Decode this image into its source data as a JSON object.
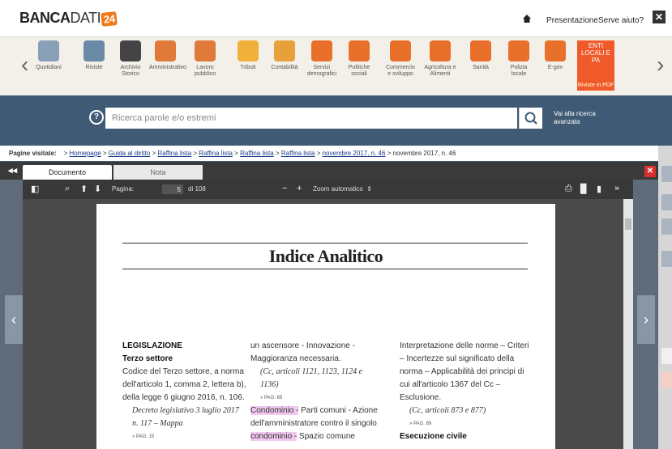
{
  "brand": {
    "name_bold": "BANCA",
    "name_light": "DATI",
    "badge": "24"
  },
  "header": {
    "presentazione": "Presentazione",
    "serve_aiuto": "Serve aiuto?",
    "close": "✕"
  },
  "categories": [
    {
      "label": "Quotidiani",
      "color": "#8aa0b8"
    },
    {
      "label": "Riviste",
      "color": "#6a8aa8"
    },
    {
      "label": "Archivio Storico",
      "color": "#444444"
    },
    {
      "label": "Amministrativo",
      "color": "#e07a3a"
    },
    {
      "label": "Lavoro pubblico",
      "color": "#e07a3a"
    },
    {
      "label": "Tributi",
      "color": "#f0b03a"
    },
    {
      "label": "Contabilità",
      "color": "#e8a03a"
    },
    {
      "label": "Servizi demografici",
      "color": "#e8702a"
    },
    {
      "label": "Politiche sociali",
      "color": "#e8702a"
    },
    {
      "label": "Commercio e sviluppo",
      "color": "#e8702a"
    },
    {
      "label": "Agricoltura e Alimenti",
      "color": "#e8702a"
    },
    {
      "label": "Sanità",
      "color": "#e8702a"
    },
    {
      "label": "Polizia locale",
      "color": "#e8702a"
    },
    {
      "label": "E-gov",
      "color": "#e8702a"
    }
  ],
  "enti": {
    "title": "ENTI LOCALI E PA",
    "sub": "Riviste in PDF"
  },
  "search": {
    "placeholder": "Ricerca parole e/o estremi",
    "advanced": "Vai alla ricerca avanzata",
    "help": "?"
  },
  "visited": {
    "label": "Pagine visitate:",
    "crumbs": [
      "Homepage",
      "Guida al diritto",
      "Raffina lista",
      "Raffina lista",
      "Raffina lista",
      "Raffina lista",
      "novembre 2017, n. 46"
    ],
    "current": "novembre 2017, n. 46"
  },
  "tabs": {
    "documento": "Documento",
    "nota": "Nota"
  },
  "pdf": {
    "page_label": "Pagina:",
    "page_value": "5",
    "page_of": "di 108",
    "zoom": "Zoom automatico"
  },
  "page": {
    "title": "Indice Analitico",
    "col1": {
      "h1": "LEGISLAZIONE",
      "h2": "Terzo settore",
      "l1": "Codice del Terzo settore, a norma",
      "l2": "dell'articolo 1, comma 2, lettera b),",
      "l3": "della legge 6 giugno 2016, n. 106.",
      "i1": "Decreto legislativo 3 luglio 2017",
      "i2": "n. 117 – Mappa",
      "pag": "» PAG. 15"
    },
    "col2": {
      "l1": "un ascensore - Innovazione -",
      "l2": "Maggioranza necessaria.",
      "i1": "(Cc, articoli 1121, 1123, 1124 e",
      "i2": "1136)",
      "pag": "» PAG. 69",
      "hl1": "Condominio -",
      "l3": " Parti comuni - Azione",
      "l4": "dell'amministratore contro il singolo",
      "hl2": "condominio -",
      "l5": " Spazio comune"
    },
    "col3": {
      "l1": "Interpretazione delle norme – Criteri",
      "l2": "– Incertezze sul significato della",
      "l3": "norma – Applicabilità dei principi di",
      "l4": "cui all'articolo 1367 del Cc –",
      "l5": "Esclusione.",
      "i1": "(Cc, articoli 873 e 877)",
      "pag": "» PAG. 69",
      "h1": "Esecuzione civile"
    }
  }
}
